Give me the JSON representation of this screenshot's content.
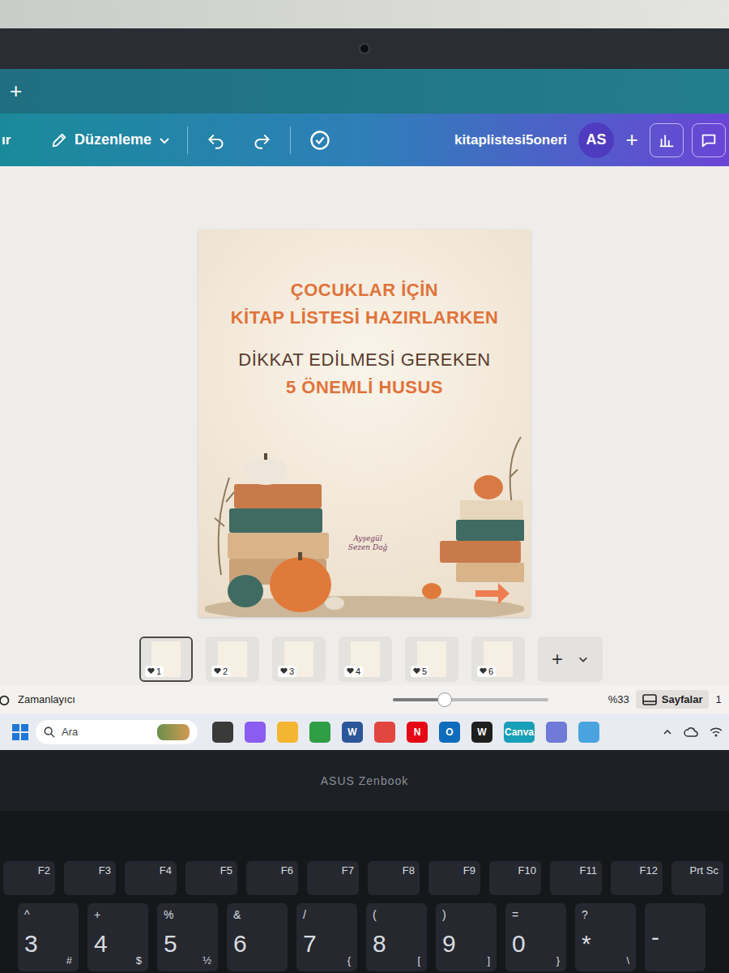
{
  "browser": {
    "new_tab": "+"
  },
  "toolbar": {
    "cut_label": "ır",
    "menu": "Düzenleme",
    "file_name": "kitaplistesi5oneri",
    "avatar": "AS",
    "add": "+"
  },
  "design": {
    "lines": [
      {
        "text": "ÇOCUKLAR İÇİN",
        "color": "#e0733a",
        "bold": true
      },
      {
        "text": "KİTAP LİSTESİ HAZIRLARKEN",
        "color": "#e0733a",
        "bold": true
      },
      {
        "text": "DİKKAT EDİLMESİ GEREKEN",
        "color": "#5a3b2e",
        "bold": false
      },
      {
        "text": "5 ÖNEMLİ HUSUS",
        "color": "#e0733a",
        "bold": true
      }
    ],
    "signature": "Ayşegül Sezen Dağ"
  },
  "pages": [
    {
      "number": "1",
      "selected": true
    },
    {
      "number": "2",
      "selected": false
    },
    {
      "number": "3",
      "selected": false
    },
    {
      "number": "4",
      "selected": false
    },
    {
      "number": "5",
      "selected": false
    },
    {
      "number": "6",
      "selected": false
    }
  ],
  "pages_add": "+",
  "footer": {
    "timer": "Zamanlayıcı",
    "zoom": {
      "level": 0.33,
      "reading": "%33"
    },
    "pages_button": "Sayfalar",
    "cut": "1"
  },
  "taskbar": {
    "search": "Ara",
    "apps": [
      {
        "kind": "tile",
        "glyph": "",
        "color": "#3a3a3a"
      },
      {
        "kind": "tile",
        "glyph": "",
        "color": "#8a5cf0"
      },
      {
        "kind": "tile",
        "glyph": "",
        "color": "#f2b632"
      },
      {
        "kind": "tile",
        "glyph": "",
        "color": "#2f9e44"
      },
      {
        "kind": "letter",
        "glyph": "W",
        "color": "#2b579a"
      },
      {
        "kind": "tile",
        "glyph": "",
        "color": "#e1463f"
      },
      {
        "kind": "letter",
        "glyph": "N",
        "color": "#e50914"
      },
      {
        "kind": "letter",
        "glyph": "O",
        "color": "#0f6cbd"
      },
      {
        "kind": "letter",
        "glyph": "W",
        "color": "#1f1f1f"
      },
      {
        "kind": "letter",
        "glyph": "Canva",
        "color": "#18a0b8"
      },
      {
        "kind": "tile",
        "glyph": "",
        "color": "#6f7bd6"
      },
      {
        "kind": "tile",
        "glyph": "",
        "color": "#4aa3df"
      }
    ]
  },
  "laptop": {
    "brand": "ASUS Zenbook"
  },
  "keyboard": {
    "function_keys": [
      "F2",
      "F3",
      "F4",
      "F5",
      "F6",
      "F7",
      "F8",
      "F9",
      "F10",
      "F11",
      "F12",
      "Prt Sc"
    ],
    "number_keys": [
      {
        "shift": "^",
        "main": "3",
        "alt": "#"
      },
      {
        "shift": "+",
        "main": "4",
        "alt": "$"
      },
      {
        "shift": "%",
        "main": "5",
        "alt": "½"
      },
      {
        "shift": "&",
        "main": "6",
        "alt": ""
      },
      {
        "shift": "/",
        "main": "7",
        "alt": "{"
      },
      {
        "shift": "(",
        "main": "8",
        "alt": "["
      },
      {
        "shift": ")",
        "main": "9",
        "alt": "]"
      },
      {
        "shift": "=",
        "main": "0",
        "alt": "}"
      },
      {
        "shift": "?",
        "main": "*",
        "alt": "\\"
      },
      {
        "shift": "",
        "main": "-",
        "alt": ""
      }
    ]
  }
}
